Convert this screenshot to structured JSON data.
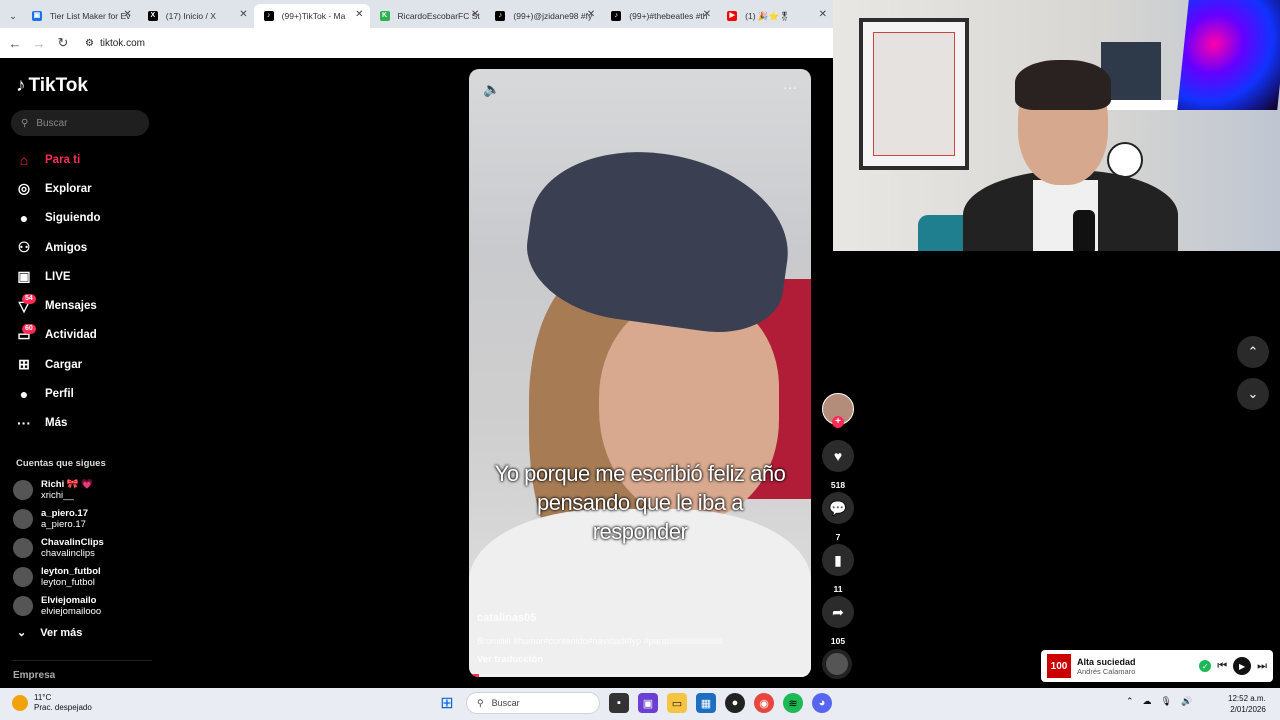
{
  "browser": {
    "tabs": [
      {
        "title": "Tier List Maker for Ev",
        "favicon_color": "#1a73e8",
        "favicon": "▣"
      },
      {
        "title": "(17) Inicio / X",
        "favicon_color": "#000000",
        "favicon": "X"
      },
      {
        "title": "(99+)TikTok - Ma",
        "favicon_color": "#000000",
        "favicon": "♪",
        "active": true
      },
      {
        "title": "RicardoEscobarFC St",
        "favicon_color": "#2bb24c",
        "favicon": "K"
      },
      {
        "title": "(99+)@jzidane98 #fy",
        "favicon_color": "#000000",
        "favicon": "♪"
      },
      {
        "title": "(99+)#thebeatles #th",
        "favicon_color": "#000000",
        "favicon": "♪"
      },
      {
        "title": "(1) 🎉⭐🎖",
        "favicon_color": "#ff0000",
        "favicon": "▶"
      }
    ],
    "url": "tiktok.com"
  },
  "sidebar": {
    "logo": "TikTok",
    "search_placeholder": "Buscar",
    "nav": [
      {
        "label": "Para ti",
        "icon": "home-icon",
        "glyph": "⌂",
        "active": true
      },
      {
        "label": "Explorar",
        "icon": "compass-icon",
        "glyph": "◎"
      },
      {
        "label": "Siguiendo",
        "icon": "following-avatar-icon",
        "glyph": "●"
      },
      {
        "label": "Amigos",
        "icon": "friends-icon",
        "glyph": "⚇"
      },
      {
        "label": "LIVE",
        "icon": "live-icon",
        "glyph": "▣"
      },
      {
        "label": "Mensajes",
        "icon": "messages-icon",
        "glyph": "▽",
        "badge": "54"
      },
      {
        "label": "Actividad",
        "icon": "activity-icon",
        "glyph": "▭",
        "badge": "60"
      },
      {
        "label": "Cargar",
        "icon": "upload-icon",
        "glyph": "⊞"
      },
      {
        "label": "Perfil",
        "icon": "profile-avatar-icon",
        "glyph": "●"
      },
      {
        "label": "Más",
        "icon": "more-icon",
        "glyph": "···"
      }
    ],
    "following_title": "Cuentas que sigues",
    "following": [
      {
        "name": "Richi 🎀 💗",
        "handle": "xrichi__"
      },
      {
        "name": "a_piero.17",
        "handle": "a_piero.17"
      },
      {
        "name": "ChavalinClips",
        "handle": "chavalinclips"
      },
      {
        "name": "leyton_futbol",
        "handle": "leyton_futbol"
      },
      {
        "name": "Elviejomailo",
        "handle": "elviejomailooo"
      }
    ],
    "see_more": "Ver más",
    "empresa": "Empresa"
  },
  "video": {
    "caption": "Yo porque me escribió feliz año pensando que le iba a responder",
    "username": "catalinas05",
    "description": "Bromiiiiii #humor#contenido#navidad#fyp #paratiiiiiiiiiiiiiiiiiiiiiiiiiii",
    "translate": "Ver traducción",
    "progress_percent": 3
  },
  "actions": {
    "likes": "518",
    "comments": "7",
    "saves": "11",
    "shares": "105"
  },
  "player": {
    "cover": "100",
    "title": "Alta suciedad",
    "artist": "Andrés Calamaro"
  },
  "taskbar": {
    "temp": "11°C",
    "weather": "Prac. despejado",
    "search": "Buscar",
    "time": "12:52 a.m.",
    "date": "2/01/2026"
  }
}
